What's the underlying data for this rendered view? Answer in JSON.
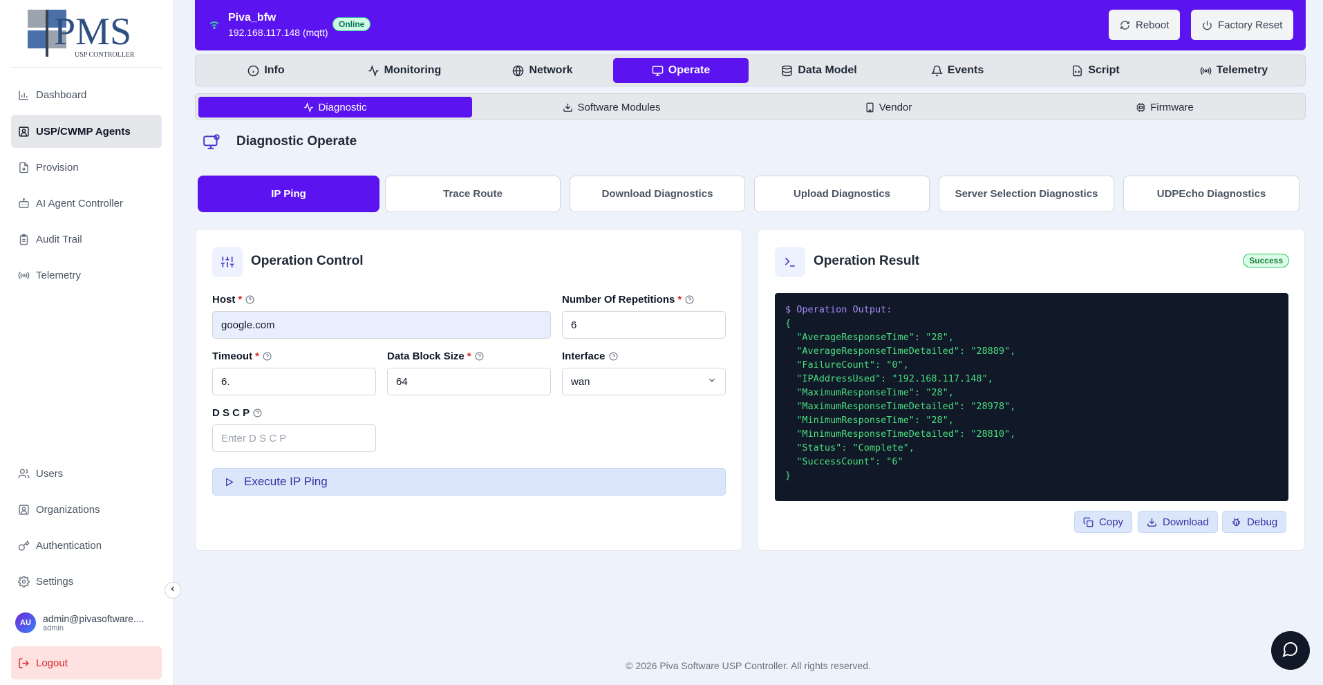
{
  "logo": {
    "text": "PMS",
    "subtitle": "USP CONTROLLER"
  },
  "sidebar": {
    "items": [
      {
        "label": "Dashboard",
        "icon": "bar-chart-icon"
      },
      {
        "label": "USP/CWMP Agents",
        "icon": "agents-icon",
        "active": true
      },
      {
        "label": "Provision",
        "icon": "file-cog-icon"
      },
      {
        "label": "AI Agent Controller",
        "icon": "bot-icon"
      },
      {
        "label": "Audit Trail",
        "icon": "clipboard-icon"
      },
      {
        "label": "Telemetry",
        "icon": "radio-icon"
      }
    ],
    "bottom_items": [
      {
        "label": "Users",
        "icon": "users-icon"
      },
      {
        "label": "Organizations",
        "icon": "organizations-icon"
      },
      {
        "label": "Authentication",
        "icon": "key-icon"
      },
      {
        "label": "Settings",
        "icon": "gear-icon"
      }
    ],
    "user": {
      "initials": "AU",
      "email": "admin@pivasoftware....",
      "role": "admin"
    },
    "logout_label": "Logout"
  },
  "header": {
    "device_name": "Piva_bfw",
    "device_ip": "192.168.117.148 (mqtt)",
    "status": "Online",
    "reboot_label": "Reboot",
    "factory_reset_label": "Factory Reset"
  },
  "tabs": [
    {
      "label": "Info",
      "icon": "info-icon"
    },
    {
      "label": "Monitoring",
      "icon": "activity-icon"
    },
    {
      "label": "Network",
      "icon": "globe-icon"
    },
    {
      "label": "Operate",
      "icon": "monitor-cog-icon",
      "active": true
    },
    {
      "label": "Data Model",
      "icon": "database-icon"
    },
    {
      "label": "Events",
      "icon": "bell-icon"
    },
    {
      "label": "Script",
      "icon": "file-code-icon"
    },
    {
      "label": "Telemetry",
      "icon": "radio-icon"
    }
  ],
  "subtabs": [
    {
      "label": "Diagnostic",
      "icon": "activity-icon",
      "active": true
    },
    {
      "label": "Software Modules",
      "icon": "download-icon"
    },
    {
      "label": "Vendor",
      "icon": "building-icon"
    },
    {
      "label": "Firmware",
      "icon": "cpu-icon"
    }
  ],
  "page_title": "Diagnostic Operate",
  "diagnostic_tabs": [
    {
      "label": "IP Ping",
      "active": true
    },
    {
      "label": "Trace Route"
    },
    {
      "label": "Download Diagnostics"
    },
    {
      "label": "Upload Diagnostics"
    },
    {
      "label": "Server Selection Diagnostics"
    },
    {
      "label": "UDPEcho Diagnostics"
    }
  ],
  "control": {
    "title": "Operation Control",
    "host_label": "Host",
    "host_value": "google.com",
    "repetitions_label": "Number Of Repetitions",
    "repetitions_value": "6",
    "timeout_label": "Timeout",
    "timeout_value": "6.",
    "block_size_label": "Data Block Size",
    "block_size_value": "64",
    "interface_label": "Interface",
    "interface_value": "wan",
    "dscp_label": "D S C P",
    "dscp_placeholder": "Enter D S C P",
    "required_mark": "*",
    "execute_label": "Execute IP Ping"
  },
  "result": {
    "title": "Operation Result",
    "status": "Success",
    "output_prompt": "$ Operation Output:",
    "output_lines": [
      "{",
      "  \"AverageResponseTime\": \"28\",",
      "  \"AverageResponseTimeDetailed\": \"28889\",",
      "  \"FailureCount\": \"0\",",
      "  \"IPAddressUsed\": \"192.168.117.148\",",
      "  \"MaximumResponseTime\": \"28\",",
      "  \"MaximumResponseTimeDetailed\": \"28978\",",
      "  \"MinimumResponseTime\": \"28\",",
      "  \"MinimumResponseTimeDetailed\": \"28810\",",
      "  \"Status\": \"Complete\",",
      "  \"SuccessCount\": \"6\"",
      "}"
    ],
    "copy_label": "Copy",
    "download_label": "Download",
    "debug_label": "Debug"
  },
  "footer": "© 2026 Piva Software USP Controller. All rights reserved.",
  "colors": {
    "brand": "#5b13f0",
    "online": "#34d399",
    "success": "#22c55e",
    "terminal_bg": "#111827",
    "terminal_text": "#4ade80"
  }
}
